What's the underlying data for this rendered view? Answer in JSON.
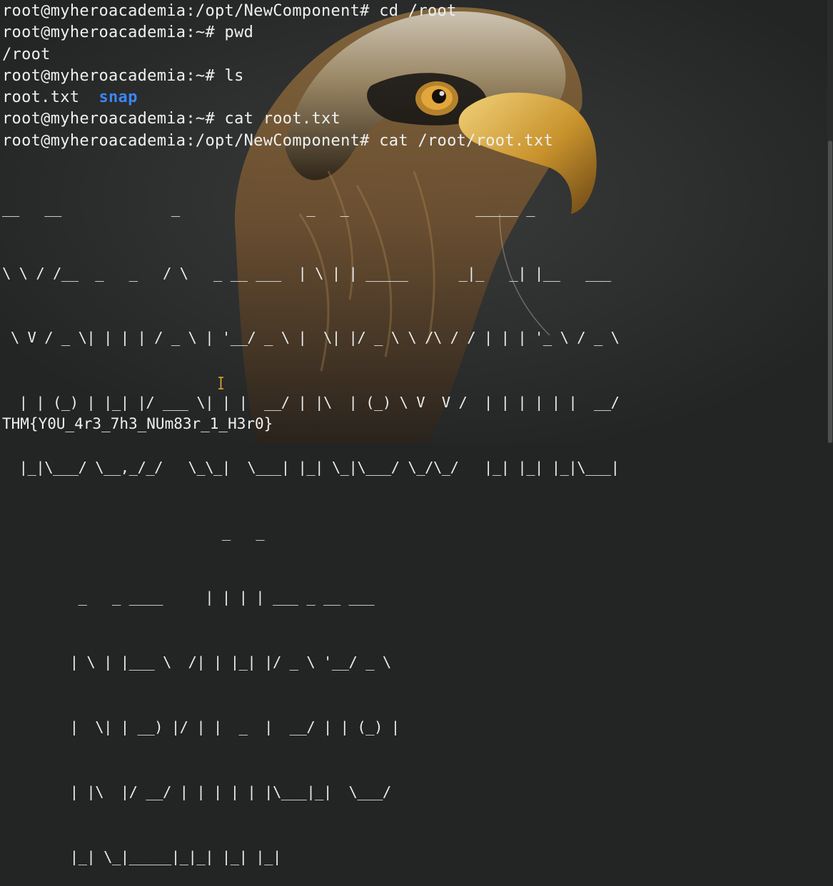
{
  "terminal": {
    "lines": [
      "root@myheroacademia:/opt/NewComponent# cd /root",
      "root@myheroacademia:~# pwd",
      "/root",
      "root@myheroacademia:~# ls",
      "root.txt",
      "root@myheroacademia:~# cat root.txt",
      "root@myheroacademia:/opt/NewComponent# cat /root/root.txt"
    ],
    "ls_dir_entry": "snap",
    "ls_gap": "  ",
    "banner": [
      "__   __             _               _   _               _____ _",
      "\\ \\ / /__  _   _   / \\   _ __ ___  | \\ | | _____      _|_   _| |__   ___",
      " \\ V / _ \\| | | | / _ \\ | '__/ _ \\ |  \\| |/ _ \\ \\ /\\ / / | | | '_ \\ / _ \\",
      "  | | (_) | |_| |/ ___ \\| | |  __/ | |\\  | (_) \\ V  V /  | | | | | |  __/",
      "  |_|\\___/ \\__,_/_/   \\_\\_|  \\___| |_| \\_|\\___/ \\_/\\_/   |_| |_| |_|\\___|",
      "                          _   _",
      "         _   _ ____     | | | | ___ _ __ ___",
      "        | \\ | |___ \\  /| | |_| |/ _ \\ '__/ _ \\",
      "        |  \\| | __) |/ | |  _  |  __/ | | (_) |",
      "        | |\\  |/ __/ | | | | | |\\___|_|  \\___/",
      "        |_| \\_|_____|_|_| |_| |_|"
    ],
    "flag": "THM{Y0U_4r3_7h3_NUm83r_1_H3r0}"
  },
  "colors": {
    "background": "#232424",
    "foreground": "#eef1f1",
    "directory": "#3b86f5",
    "cursor": "#e8b030"
  },
  "icons": {
    "wallpaper": "eagle-wallpaper",
    "cursor": "text-cursor-icon"
  }
}
